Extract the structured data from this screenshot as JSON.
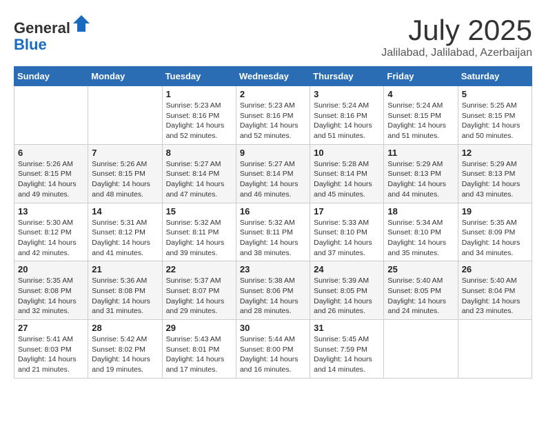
{
  "header": {
    "logo_general": "General",
    "logo_blue": "Blue",
    "month_title": "July 2025",
    "location": "Jalilabad, Jalilabad, Azerbaijan"
  },
  "weekdays": [
    "Sunday",
    "Monday",
    "Tuesday",
    "Wednesday",
    "Thursday",
    "Friday",
    "Saturday"
  ],
  "weeks": [
    [
      {
        "day": "",
        "sunrise": "",
        "sunset": "",
        "daylight": ""
      },
      {
        "day": "",
        "sunrise": "",
        "sunset": "",
        "daylight": ""
      },
      {
        "day": "1",
        "sunrise": "Sunrise: 5:23 AM",
        "sunset": "Sunset: 8:16 PM",
        "daylight": "Daylight: 14 hours and 52 minutes."
      },
      {
        "day": "2",
        "sunrise": "Sunrise: 5:23 AM",
        "sunset": "Sunset: 8:16 PM",
        "daylight": "Daylight: 14 hours and 52 minutes."
      },
      {
        "day": "3",
        "sunrise": "Sunrise: 5:24 AM",
        "sunset": "Sunset: 8:16 PM",
        "daylight": "Daylight: 14 hours and 51 minutes."
      },
      {
        "day": "4",
        "sunrise": "Sunrise: 5:24 AM",
        "sunset": "Sunset: 8:15 PM",
        "daylight": "Daylight: 14 hours and 51 minutes."
      },
      {
        "day": "5",
        "sunrise": "Sunrise: 5:25 AM",
        "sunset": "Sunset: 8:15 PM",
        "daylight": "Daylight: 14 hours and 50 minutes."
      }
    ],
    [
      {
        "day": "6",
        "sunrise": "Sunrise: 5:26 AM",
        "sunset": "Sunset: 8:15 PM",
        "daylight": "Daylight: 14 hours and 49 minutes."
      },
      {
        "day": "7",
        "sunrise": "Sunrise: 5:26 AM",
        "sunset": "Sunset: 8:15 PM",
        "daylight": "Daylight: 14 hours and 48 minutes."
      },
      {
        "day": "8",
        "sunrise": "Sunrise: 5:27 AM",
        "sunset": "Sunset: 8:14 PM",
        "daylight": "Daylight: 14 hours and 47 minutes."
      },
      {
        "day": "9",
        "sunrise": "Sunrise: 5:27 AM",
        "sunset": "Sunset: 8:14 PM",
        "daylight": "Daylight: 14 hours and 46 minutes."
      },
      {
        "day": "10",
        "sunrise": "Sunrise: 5:28 AM",
        "sunset": "Sunset: 8:14 PM",
        "daylight": "Daylight: 14 hours and 45 minutes."
      },
      {
        "day": "11",
        "sunrise": "Sunrise: 5:29 AM",
        "sunset": "Sunset: 8:13 PM",
        "daylight": "Daylight: 14 hours and 44 minutes."
      },
      {
        "day": "12",
        "sunrise": "Sunrise: 5:29 AM",
        "sunset": "Sunset: 8:13 PM",
        "daylight": "Daylight: 14 hours and 43 minutes."
      }
    ],
    [
      {
        "day": "13",
        "sunrise": "Sunrise: 5:30 AM",
        "sunset": "Sunset: 8:12 PM",
        "daylight": "Daylight: 14 hours and 42 minutes."
      },
      {
        "day": "14",
        "sunrise": "Sunrise: 5:31 AM",
        "sunset": "Sunset: 8:12 PM",
        "daylight": "Daylight: 14 hours and 41 minutes."
      },
      {
        "day": "15",
        "sunrise": "Sunrise: 5:32 AM",
        "sunset": "Sunset: 8:11 PM",
        "daylight": "Daylight: 14 hours and 39 minutes."
      },
      {
        "day": "16",
        "sunrise": "Sunrise: 5:32 AM",
        "sunset": "Sunset: 8:11 PM",
        "daylight": "Daylight: 14 hours and 38 minutes."
      },
      {
        "day": "17",
        "sunrise": "Sunrise: 5:33 AM",
        "sunset": "Sunset: 8:10 PM",
        "daylight": "Daylight: 14 hours and 37 minutes."
      },
      {
        "day": "18",
        "sunrise": "Sunrise: 5:34 AM",
        "sunset": "Sunset: 8:10 PM",
        "daylight": "Daylight: 14 hours and 35 minutes."
      },
      {
        "day": "19",
        "sunrise": "Sunrise: 5:35 AM",
        "sunset": "Sunset: 8:09 PM",
        "daylight": "Daylight: 14 hours and 34 minutes."
      }
    ],
    [
      {
        "day": "20",
        "sunrise": "Sunrise: 5:35 AM",
        "sunset": "Sunset: 8:08 PM",
        "daylight": "Daylight: 14 hours and 32 minutes."
      },
      {
        "day": "21",
        "sunrise": "Sunrise: 5:36 AM",
        "sunset": "Sunset: 8:08 PM",
        "daylight": "Daylight: 14 hours and 31 minutes."
      },
      {
        "day": "22",
        "sunrise": "Sunrise: 5:37 AM",
        "sunset": "Sunset: 8:07 PM",
        "daylight": "Daylight: 14 hours and 29 minutes."
      },
      {
        "day": "23",
        "sunrise": "Sunrise: 5:38 AM",
        "sunset": "Sunset: 8:06 PM",
        "daylight": "Daylight: 14 hours and 28 minutes."
      },
      {
        "day": "24",
        "sunrise": "Sunrise: 5:39 AM",
        "sunset": "Sunset: 8:05 PM",
        "daylight": "Daylight: 14 hours and 26 minutes."
      },
      {
        "day": "25",
        "sunrise": "Sunrise: 5:40 AM",
        "sunset": "Sunset: 8:05 PM",
        "daylight": "Daylight: 14 hours and 24 minutes."
      },
      {
        "day": "26",
        "sunrise": "Sunrise: 5:40 AM",
        "sunset": "Sunset: 8:04 PM",
        "daylight": "Daylight: 14 hours and 23 minutes."
      }
    ],
    [
      {
        "day": "27",
        "sunrise": "Sunrise: 5:41 AM",
        "sunset": "Sunset: 8:03 PM",
        "daylight": "Daylight: 14 hours and 21 minutes."
      },
      {
        "day": "28",
        "sunrise": "Sunrise: 5:42 AM",
        "sunset": "Sunset: 8:02 PM",
        "daylight": "Daylight: 14 hours and 19 minutes."
      },
      {
        "day": "29",
        "sunrise": "Sunrise: 5:43 AM",
        "sunset": "Sunset: 8:01 PM",
        "daylight": "Daylight: 14 hours and 17 minutes."
      },
      {
        "day": "30",
        "sunrise": "Sunrise: 5:44 AM",
        "sunset": "Sunset: 8:00 PM",
        "daylight": "Daylight: 14 hours and 16 minutes."
      },
      {
        "day": "31",
        "sunrise": "Sunrise: 5:45 AM",
        "sunset": "Sunset: 7:59 PM",
        "daylight": "Daylight: 14 hours and 14 minutes."
      },
      {
        "day": "",
        "sunrise": "",
        "sunset": "",
        "daylight": ""
      },
      {
        "day": "",
        "sunrise": "",
        "sunset": "",
        "daylight": ""
      }
    ]
  ]
}
